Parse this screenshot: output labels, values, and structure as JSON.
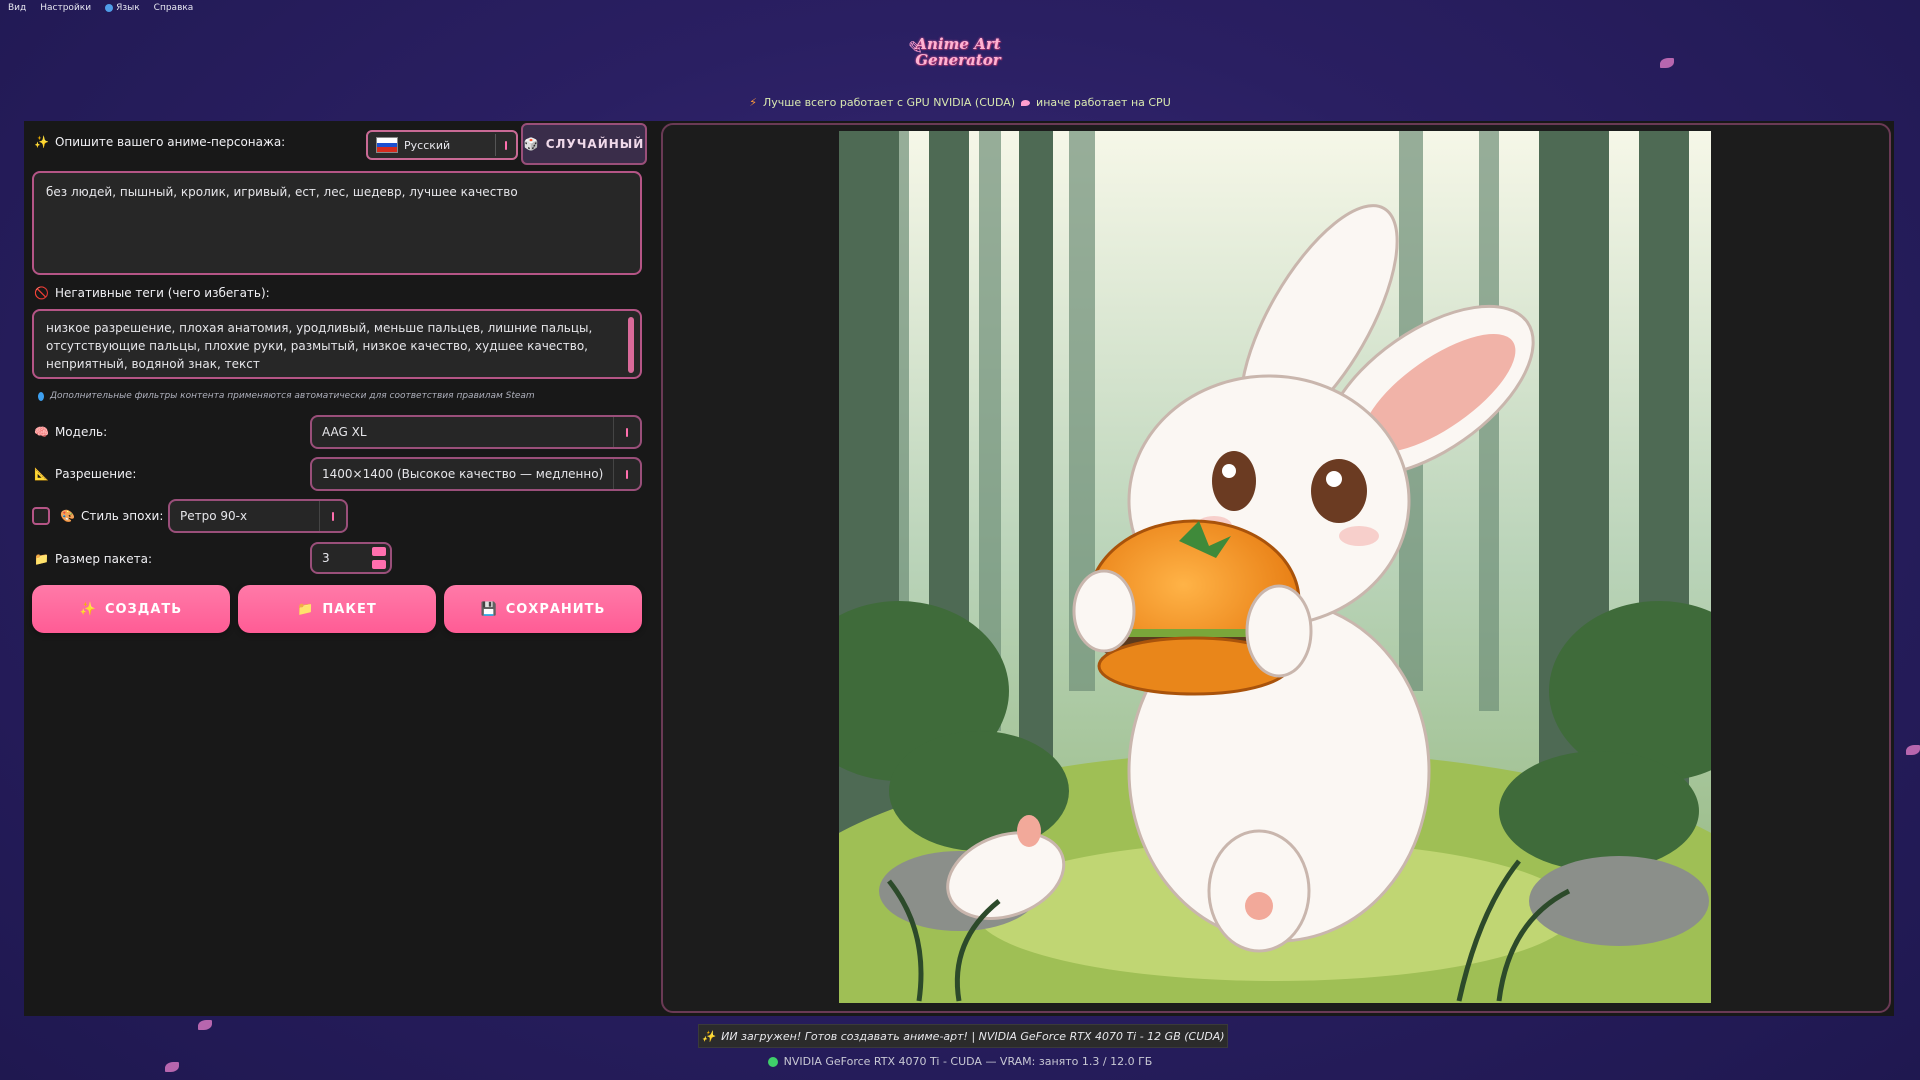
{
  "menu": {
    "view": "Вид",
    "settings": "Настройки",
    "language": "Язык",
    "help": "Справка"
  },
  "logo": {
    "line1": "Anime Art",
    "line2": "Generator"
  },
  "gpu_note": {
    "part1": "Лучше всего работает с GPU NVIDIA (CUDA)",
    "part2": "иначе работает на CPU"
  },
  "prompt": {
    "label": "Опишите вашего аниме-персонажа:",
    "value": "без людей, пышный, кролик, игривый, ест, лес, шедевр, лучшее качество"
  },
  "language_select": {
    "value": "Русский"
  },
  "random_button": {
    "label": "СЛУЧАЙНЫЙ"
  },
  "negative": {
    "label": "Негативные теги (чего избегать):",
    "value": "низкое разрешение, плохая анатомия, уродливый, меньше пальцев, лишние пальцы, отсутствующие пальцы, плохие руки, размытый, низкое качество, худшее качество, неприятный, водяной знак, текст"
  },
  "filter_hint": "Дополнительные фильтры контента применяются автоматически для соответствия правилам Steam",
  "model": {
    "label": "Модель:",
    "value": "AAG XL"
  },
  "resolution": {
    "label": "Разрешение:",
    "value": "1400×1400 (Высокое качество — медленно)"
  },
  "era_style": {
    "label": "Стиль эпохи:",
    "value": "Ретро 90-х"
  },
  "batch_size": {
    "label": "Размер пакета:",
    "value": "3"
  },
  "buttons": {
    "create": "СОЗДАТЬ",
    "batch": "ПАКЕТ",
    "save": "СОХРАНИТЬ"
  },
  "status": "ИИ загружен! Готов создавать аниме-арт! | NVIDIA GeForce RTX 4070 Ti - 12 GB (CUDA)",
  "vram": "NVIDIA GeForce RTX 4070 Ti - CUDA — VRAM: занято 1.3 / 12.0 ГБ",
  "colors": {
    "accent": "#ff6fae",
    "border": "#b55586",
    "panel": "#181818",
    "background": "#2a1f62"
  }
}
